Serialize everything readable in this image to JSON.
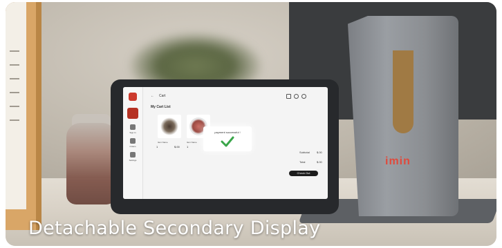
{
  "caption": "Detachable Secondary Display",
  "brand": "imin",
  "screen": {
    "header": {
      "back": "←",
      "title": "Cart"
    },
    "cart_title": "My Cart List",
    "sidebar": {
      "labels": [
        "Sign In",
        "Orders",
        "Settings"
      ]
    },
    "items": [
      {
        "name": "Item Name",
        "qty": "1",
        "price": "$.00"
      },
      {
        "name": "Item Name",
        "qty": "1",
        "price": ""
      }
    ],
    "totals": [
      {
        "label": "Subtotal",
        "value": "$.00"
      },
      {
        "label": "Total",
        "value": "$.00"
      }
    ],
    "pay_button": "Check Out",
    "modal": {
      "message": "payment successful !"
    }
  },
  "colors": {
    "accent": "#cc3a2d",
    "success": "#3aa64a",
    "brand": "#e04a3c"
  },
  "icons": [
    "arrow-left-icon",
    "cart-icon",
    "search-icon",
    "user-icon",
    "check-icon"
  ]
}
